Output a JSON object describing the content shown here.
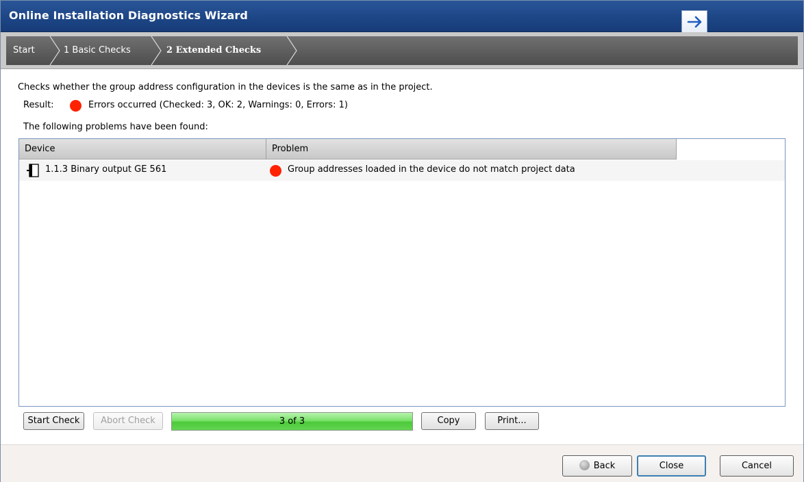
{
  "window": {
    "title": "Online Installation Diagnostics Wizard"
  },
  "title_button_icon": "arrow-right-icon",
  "breadcrumb": [
    "Start",
    "1 Basic Checks",
    "2 Extended Checks"
  ],
  "description": "Checks whether the group address configuration in the devices is the same as in the project.",
  "result": {
    "label": "Result:",
    "status_color": "#ff2200",
    "text": "Errors occurred (Checked: 3, OK: 2, Warnings: 0, Errors: 1)"
  },
  "problems_label": "The following problems have been found:",
  "table": {
    "columns": [
      "Device",
      "Problem"
    ],
    "rows": [
      {
        "device": "1.1.3  Binary output GE 561",
        "device_icon": "device-icon",
        "problem": "Group addresses loaded in the device do not match project data",
        "severity_color": "#ff2200"
      }
    ]
  },
  "toolbar": {
    "start_check": "Start Check",
    "abort_check": "Abort Check",
    "progress_text": "3 of 3",
    "progress_fraction": 1.0,
    "copy": "Copy",
    "print": "Print..."
  },
  "footer": {
    "back": "Back",
    "back_icon": "back-circle-icon",
    "close": "Close",
    "cancel": "Cancel"
  }
}
